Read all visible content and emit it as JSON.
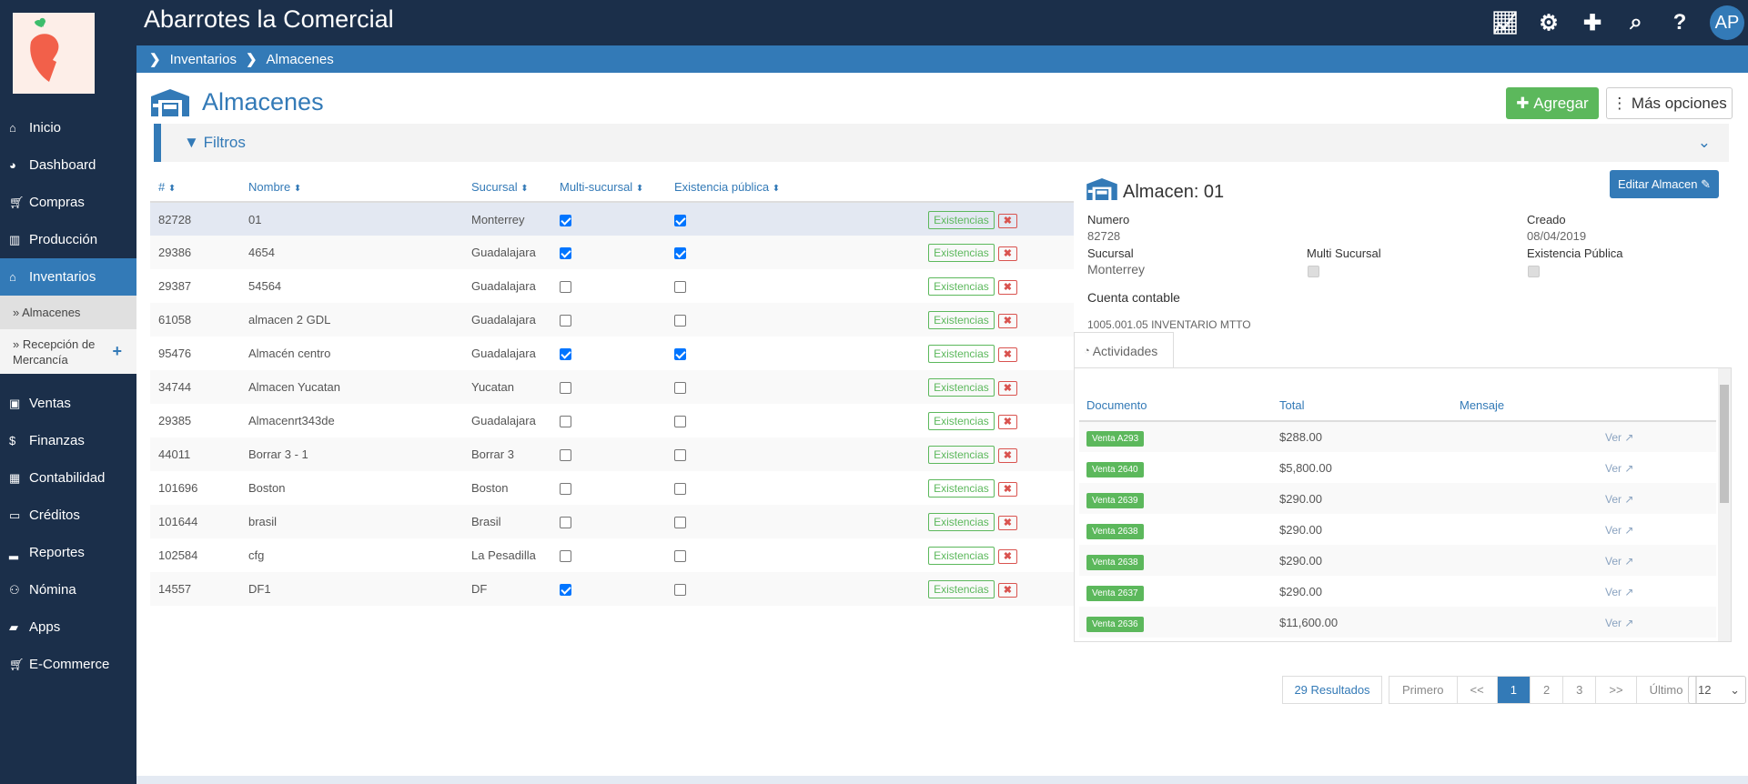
{
  "app": {
    "title": "Abarrotes la Comercial",
    "avatar": "AP",
    "header_icons": [
      "chart-line-icon",
      "gear-icon",
      "plus-icon",
      "search-icon",
      "question-icon"
    ]
  },
  "colors": {
    "topbar": "#1b2f4a",
    "primary": "#337ab7",
    "success": "#5cb85c",
    "danger": "#d9534f"
  },
  "sidebar": {
    "items": [
      {
        "label": "Inicio",
        "icon": "home-icon"
      },
      {
        "label": "Dashboard",
        "icon": "dashboard-icon"
      },
      {
        "label": "Compras",
        "icon": "cart-icon"
      },
      {
        "label": "Producción",
        "icon": "factory-icon"
      },
      {
        "label": "Inventarios",
        "icon": "warehouse-icon",
        "active": true
      }
    ],
    "sub": [
      {
        "label": "» Almacenes"
      },
      {
        "label": "» Recepción de Mercancía"
      }
    ],
    "items2": [
      {
        "label": "Ventas",
        "icon": "sales-icon"
      },
      {
        "label": "Finanzas",
        "icon": "dollar-icon"
      },
      {
        "label": "Contabilidad",
        "icon": "calculator-icon"
      },
      {
        "label": "Créditos",
        "icon": "credit-card-icon"
      },
      {
        "label": "Reportes",
        "icon": "signal-icon"
      },
      {
        "label": "Nómina",
        "icon": "users-icon"
      },
      {
        "label": "Apps",
        "icon": "briefcase-icon"
      },
      {
        "label": "E-Commerce",
        "icon": "cart-icon"
      }
    ]
  },
  "breadcrumb": [
    "Inventarios",
    "Almacenes"
  ],
  "page": {
    "title": "Almacenes",
    "add": "Agregar",
    "more": "Más opciones",
    "filters": "Filtros"
  },
  "table": {
    "headers": [
      "#",
      "Nombre",
      "Sucursal",
      "Multi-sucursal",
      "Existencia pública"
    ],
    "stock_label": "Existencias",
    "rows": [
      {
        "id": "82728",
        "name": "01",
        "branch": "Monterrey",
        "multi": true,
        "public": true
      },
      {
        "id": "29386",
        "name": "4654",
        "branch": "Guadalajara",
        "multi": true,
        "public": true
      },
      {
        "id": "29387",
        "name": "54564",
        "branch": "Guadalajara",
        "multi": false,
        "public": false
      },
      {
        "id": "61058",
        "name": "almacen 2 GDL",
        "branch": "Guadalajara",
        "multi": false,
        "public": false
      },
      {
        "id": "95476",
        "name": "Almacén centro",
        "branch": "Guadalajara",
        "multi": true,
        "public": true
      },
      {
        "id": "34744",
        "name": "Almacen Yucatan",
        "branch": "Yucatan",
        "multi": false,
        "public": false
      },
      {
        "id": "29385",
        "name": "Almacenrt343de",
        "branch": "Guadalajara",
        "multi": false,
        "public": false
      },
      {
        "id": "44011",
        "name": "Borrar 3 - 1",
        "branch": "Borrar 3",
        "multi": false,
        "public": false
      },
      {
        "id": "101696",
        "name": "Boston",
        "branch": "Boston",
        "multi": false,
        "public": false
      },
      {
        "id": "101644",
        "name": "brasil",
        "branch": "Brasil",
        "multi": false,
        "public": false
      },
      {
        "id": "102584",
        "name": "cfg",
        "branch": "La Pesadilla",
        "multi": false,
        "public": false
      },
      {
        "id": "14557",
        "name": "DF1",
        "branch": "DF",
        "multi": true,
        "public": false
      }
    ]
  },
  "detail": {
    "title": "Almacen: 01",
    "edit": "Editar Almacen",
    "numero_label": "Numero",
    "numero": "82728",
    "creado_label": "Creado",
    "creado": "08/04/2019",
    "sucursal_label": "Sucursal",
    "sucursal": "Monterrey",
    "multi_label": "Multi Sucursal",
    "publica_label": "Existencia Pública",
    "cuenta_label": "Cuenta contable",
    "cuenta": "1005.001.05 INVENTARIO MTTO",
    "tab": "Actividades",
    "activity_headers": [
      "Documento",
      "Total",
      "Mensaje"
    ],
    "view_label": "Ver",
    "activities": [
      {
        "doc": "Venta A293",
        "total": "$288.00"
      },
      {
        "doc": "Venta 2640",
        "total": "$5,800.00"
      },
      {
        "doc": "Venta 2639",
        "total": "$290.00"
      },
      {
        "doc": "Venta 2638",
        "total": "$290.00"
      },
      {
        "doc": "Venta 2638",
        "total": "$290.00"
      },
      {
        "doc": "Venta 2637",
        "total": "$290.00"
      },
      {
        "doc": "Venta 2636",
        "total": "$11,600.00"
      }
    ]
  },
  "pagination": {
    "results": "29 Resultados",
    "pages": [
      "Primero",
      "<<",
      "1",
      "2",
      "3",
      ">>",
      "Último"
    ],
    "current": "1",
    "per_page": "12"
  }
}
